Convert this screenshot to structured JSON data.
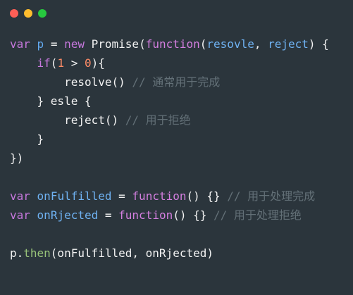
{
  "window": {
    "controls": {
      "close_color": "#ff5f56",
      "minimize_color": "#ffbd2e",
      "zoom_color": "#27c93f"
    }
  },
  "code": {
    "lines": [
      [
        {
          "type": "kw",
          "text": "var"
        },
        {
          "type": "plain",
          "text": " "
        },
        {
          "type": "var",
          "text": "p"
        },
        {
          "type": "plain",
          "text": " = "
        },
        {
          "type": "kw",
          "text": "new"
        },
        {
          "type": "plain",
          "text": " Promise("
        },
        {
          "type": "fn",
          "text": "function"
        },
        {
          "type": "plain",
          "text": "("
        },
        {
          "type": "id",
          "text": "resovle"
        },
        {
          "type": "plain",
          "text": ", "
        },
        {
          "type": "id",
          "text": "reject"
        },
        {
          "type": "plain",
          "text": ") {"
        }
      ],
      [
        {
          "type": "plain",
          "text": "    "
        },
        {
          "type": "kw",
          "text": "if"
        },
        {
          "type": "plain",
          "text": "("
        },
        {
          "type": "num",
          "text": "1"
        },
        {
          "type": "plain",
          "text": " > "
        },
        {
          "type": "num",
          "text": "0"
        },
        {
          "type": "plain",
          "text": "){"
        }
      ],
      [
        {
          "type": "plain",
          "text": "        resolve() "
        },
        {
          "type": "comment",
          "text": "// 通常用于完成"
        }
      ],
      [
        {
          "type": "plain",
          "text": "    } esle {"
        }
      ],
      [
        {
          "type": "plain",
          "text": "        reject() "
        },
        {
          "type": "comment",
          "text": "// 用于拒绝"
        }
      ],
      [
        {
          "type": "plain",
          "text": "    }"
        }
      ],
      [
        {
          "type": "plain",
          "text": "})"
        }
      ],
      [],
      [
        {
          "type": "kw",
          "text": "var"
        },
        {
          "type": "plain",
          "text": " "
        },
        {
          "type": "id",
          "text": "onFulfilled"
        },
        {
          "type": "plain",
          "text": " = "
        },
        {
          "type": "fn",
          "text": "function"
        },
        {
          "type": "plain",
          "text": "() {} "
        },
        {
          "type": "comment",
          "text": "// 用于处理完成"
        }
      ],
      [
        {
          "type": "kw",
          "text": "var"
        },
        {
          "type": "plain",
          "text": " "
        },
        {
          "type": "id",
          "text": "onRjected"
        },
        {
          "type": "plain",
          "text": " = "
        },
        {
          "type": "fn",
          "text": "function"
        },
        {
          "type": "plain",
          "text": "() {} "
        },
        {
          "type": "comment",
          "text": "// 用于处理拒绝"
        }
      ],
      [],
      [
        {
          "type": "plain",
          "text": "p."
        },
        {
          "type": "method",
          "text": "then"
        },
        {
          "type": "plain",
          "text": "(onFulfilled, onRjected)"
        }
      ]
    ]
  }
}
